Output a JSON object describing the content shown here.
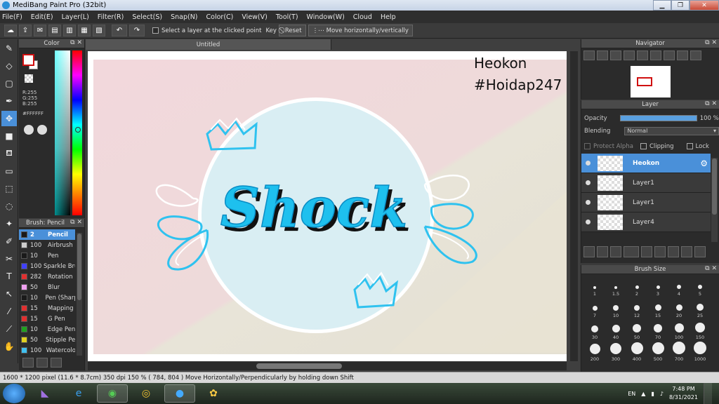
{
  "app": {
    "title": "MediBang Paint Pro (32bit)"
  },
  "menu": [
    "File(F)",
    "Edit(E)",
    "Layer(L)",
    "Filter(R)",
    "Select(S)",
    "Snap(N)",
    "Color(C)",
    "View(V)",
    "Tool(T)",
    "Window(W)",
    "Cloud",
    "Help"
  ],
  "toolbar": {
    "select_layer_label": "Select a layer at the clicked point",
    "key_label": "Key",
    "reset_label": "Reset",
    "move_label": "Move horizontally/vertically"
  },
  "color_panel": {
    "title": "Color",
    "rgb": "R:255\nG:255\nB:255",
    "hex": "#FFFFFF",
    "fg_color": "#FFFFFF",
    "bg_color": "#FFFFFF"
  },
  "brush_panel": {
    "title": "Brush: Pencil",
    "brushes": [
      {
        "size": "2",
        "name": "Pencil",
        "color": "#1a1a1a",
        "active": true
      },
      {
        "size": "100",
        "name": "Airbrush",
        "color": "#cccccc"
      },
      {
        "size": "10",
        "name": "Pen",
        "color": "#1a1a1a"
      },
      {
        "size": "100",
        "name": "Sparkle Brush",
        "color": "#4040ff"
      },
      {
        "size": "282",
        "name": "Rotation",
        "color": "#e03030"
      },
      {
        "size": "50",
        "name": "Blur",
        "color": "#f0a0f0"
      },
      {
        "size": "10",
        "name": "Pen (Sharp)",
        "color": "#1a1a1a"
      },
      {
        "size": "15",
        "name": "Mapping",
        "color": "#e03030"
      },
      {
        "size": "15",
        "name": "G Pen",
        "color": "#e03030"
      },
      {
        "size": "10",
        "name": "Edge Pen",
        "color": "#20a020"
      },
      {
        "size": "50",
        "name": "Stipple Pen",
        "color": "#e0d020"
      },
      {
        "size": "100",
        "name": "Watercolor",
        "color": "#40c0f0"
      }
    ]
  },
  "canvas": {
    "tab_title": "Untitled",
    "watermark_line1": "Heokon",
    "watermark_line2": "#Hoidap247",
    "artwork_text": "Shock"
  },
  "navigator": {
    "title": "Navigator"
  },
  "layer_panel": {
    "title": "Layer",
    "opacity_label": "Opacity",
    "opacity_value": "100 %",
    "opacity_fraction": 1.0,
    "blending_label": "Blending",
    "blending_value": "Normal",
    "protect_alpha": "Protect Alpha",
    "clipping": "Clipping",
    "lock": "Lock",
    "layers": [
      {
        "name": "Heokon",
        "active": true
      },
      {
        "name": "Layer1",
        "active": false
      },
      {
        "name": "Layer1",
        "active": false
      },
      {
        "name": "Layer4",
        "active": false
      }
    ]
  },
  "brush_size_panel": {
    "title": "Brush Size",
    "sizes": [
      "1",
      "1.5",
      "2",
      "3",
      "4",
      "5",
      "7",
      "10",
      "12",
      "15",
      "20",
      "25",
      "30",
      "40",
      "50",
      "70",
      "100",
      "150",
      "200",
      "300",
      "400",
      "500",
      "700",
      "1000"
    ]
  },
  "status": {
    "text": "1600 * 1200 pixel   (11.6 * 8.7cm)   350 dpi   150 %   ( 784, 804 )   Move Horizontally/Perpendicularly by holding down Shift"
  },
  "taskbar": {
    "language": "EN",
    "time": "7:48 PM",
    "date": "8/31/2021"
  }
}
